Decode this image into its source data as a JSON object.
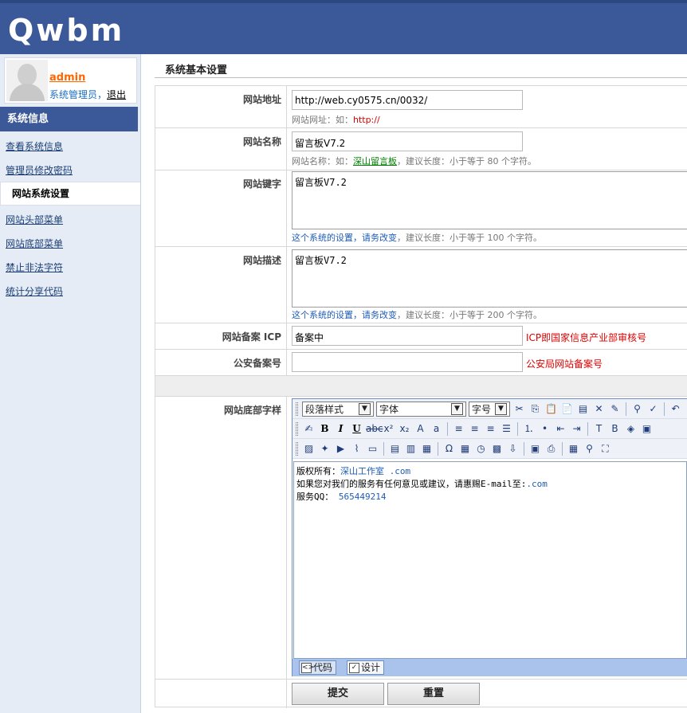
{
  "header": {
    "logo": "Qwbm"
  },
  "sidebar": {
    "user": {
      "name": "admin",
      "role": "系统管理员，",
      "logout": "退出"
    },
    "heading": "系统信息",
    "items": [
      {
        "label": "查看系统信息"
      },
      {
        "label": "管理员修改密码"
      },
      {
        "label": "网站系统设置"
      },
      {
        "label": "网站头部菜单"
      },
      {
        "label": "网站底部菜单"
      },
      {
        "label": "禁止非法字符"
      },
      {
        "label": "统计分享代码"
      }
    ]
  },
  "main": {
    "section_title": "系统基本设置",
    "fields": {
      "url": {
        "label": "网站地址",
        "value": "http://web.cy0575.cn/0032/",
        "hint_prefix": "网站网址：如：",
        "hint_red": "http://"
      },
      "name": {
        "label": "网站名称",
        "value": "留言板V7.2",
        "hint_prefix": "网站名称：如：",
        "hint_link": "深山留言板",
        "hint_suffix": "，建议长度：小于等于 80 个字符。"
      },
      "keywords": {
        "label": "网站键字",
        "value": "留言板V7.2",
        "hint_blue": "这个系统的设置，请务改变",
        "hint_suffix": "，建议长度：小于等于 100 个字符。"
      },
      "description": {
        "label": "网站描述",
        "value": "留言板V7.2",
        "hint_blue": "这个系统的设置，请务改变",
        "hint_suffix": "，建议长度：小于等于 200 个字符。"
      },
      "icp": {
        "label": "网站备案 ICP",
        "value": "备案中",
        "note": "ICP即国家信息产业部审核号"
      },
      "police": {
        "label": "公安备案号",
        "value": "",
        "note": "公安局网站备案号"
      },
      "footer": {
        "label": "网站底部字样"
      }
    },
    "editor": {
      "paragraph_select": "段落样式",
      "font_select": "字体",
      "size_select": "字号",
      "content_line1_prefix": "版权所有：",
      "content_line1_link": "深山工作室",
      "content_line1_com": ".com",
      "content_line2_prefix": "如果您对我们的服务有任何意见或建议，请惠赐E-mail至:",
      "content_line2_link": ".com",
      "content_line3_prefix": "服务QQ：",
      "content_line3_link": "565449214",
      "tab_code": "代码",
      "tab_design": "设计"
    },
    "buttons": {
      "submit": "提交",
      "reset": "重置"
    }
  }
}
